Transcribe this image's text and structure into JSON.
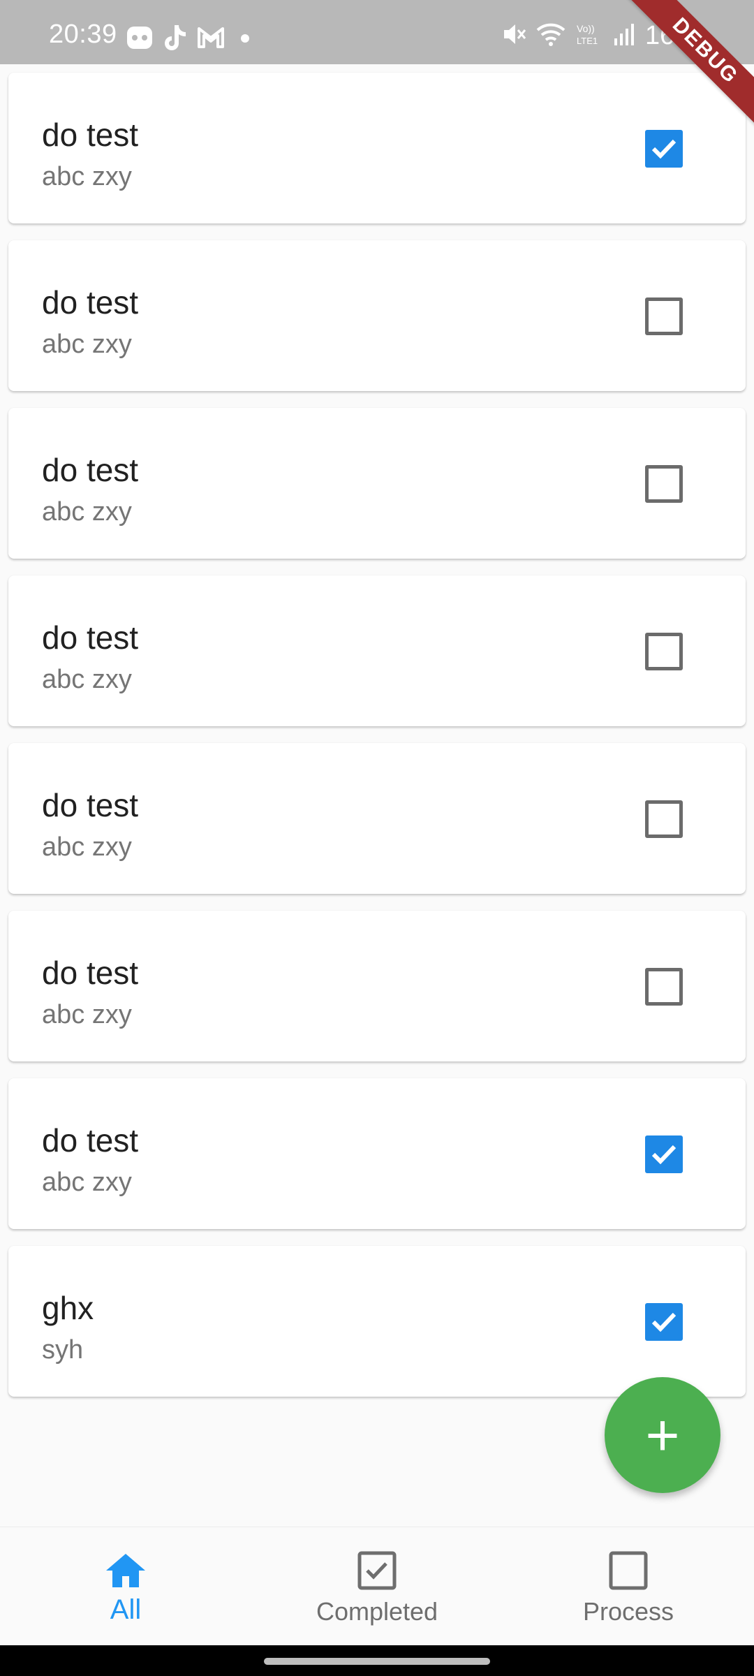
{
  "status_bar": {
    "time": "20:39",
    "battery": "16%",
    "left_icons": [
      "game-controller-icon",
      "tiktok-icon",
      "gmail-icon",
      "dot-icon"
    ],
    "right_icons": [
      "mute-icon",
      "wifi-icon",
      "volte-icon",
      "signal-icon"
    ]
  },
  "debug_banner": "DEBUG",
  "todos": [
    {
      "title": "do test",
      "subtitle": "abc zxy",
      "checked": true
    },
    {
      "title": "do test",
      "subtitle": "abc zxy",
      "checked": false
    },
    {
      "title": "do test",
      "subtitle": "abc zxy",
      "checked": false
    },
    {
      "title": "do test",
      "subtitle": "abc zxy",
      "checked": false
    },
    {
      "title": "do test",
      "subtitle": "abc zxy",
      "checked": false
    },
    {
      "title": "do test",
      "subtitle": "abc zxy",
      "checked": false
    },
    {
      "title": "do test",
      "subtitle": "abc zxy",
      "checked": true
    },
    {
      "title": "ghx",
      "subtitle": "syh",
      "checked": true
    }
  ],
  "fab": {
    "icon": "plus-icon",
    "symbol": "+"
  },
  "bottom_nav": {
    "items": [
      {
        "label": "All",
        "icon": "home-icon",
        "active": true
      },
      {
        "label": "Completed",
        "icon": "checkbox-checked-icon",
        "active": false
      },
      {
        "label": "Process",
        "icon": "checkbox-empty-icon",
        "active": false
      }
    ]
  },
  "colors": {
    "accent": "#1e88e5",
    "nav_active": "#2196f3",
    "fab": "#4caf50",
    "status_bar": "#b8b8b8",
    "debug_ribbon": "#a02c2c"
  }
}
